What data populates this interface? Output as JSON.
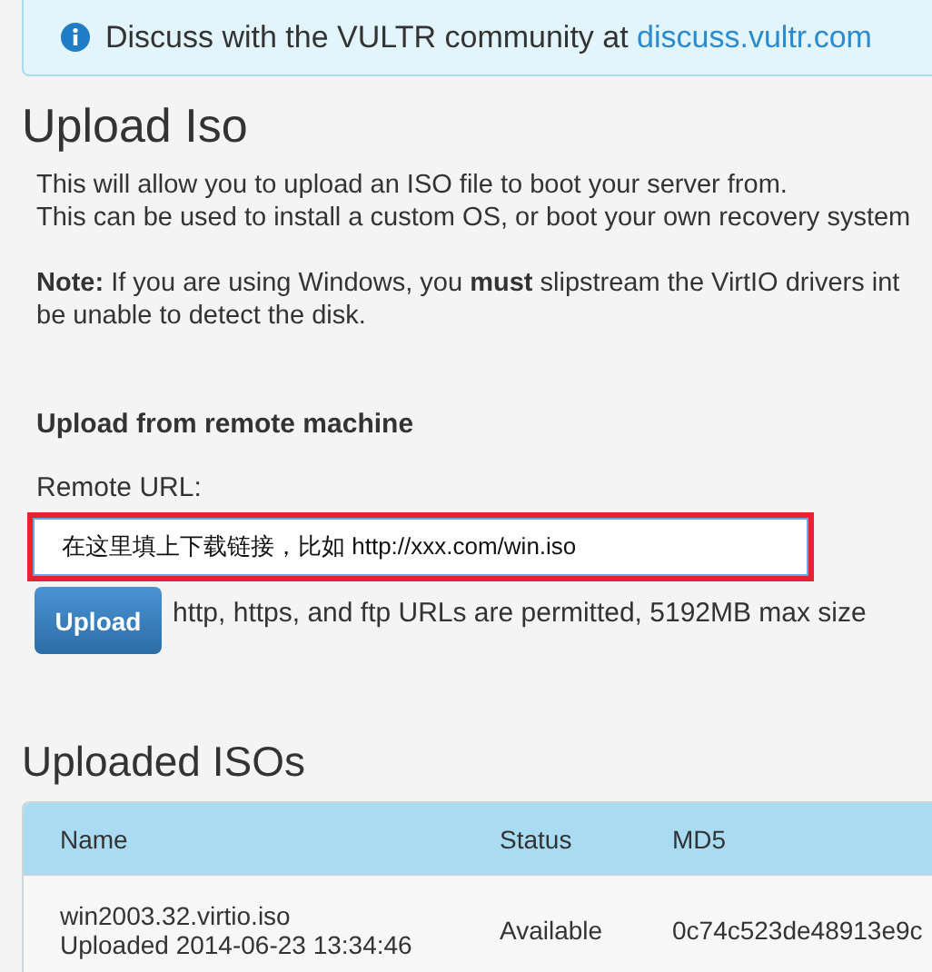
{
  "alert": {
    "text": "Discuss with the VULTR community at ",
    "link": "discuss.vultr.com"
  },
  "title": "Upload Iso",
  "intro": [
    "This will allow you to upload an ISO file to boot your server from.",
    "This can be used to install a custom OS, or boot your own recovery system"
  ],
  "note": [
    "**Note:** If you are using Windows, you **must** slipstream the VirtIO drivers int",
    "be unable to detect the disk."
  ],
  "remote": {
    "heading": "Upload from remote machine",
    "label": "Remote URL:",
    "value": "在这里填上下载链接，比如 http://xxx.com/win.iso",
    "highlighted": true,
    "button": "Upload",
    "hint": "http, https, and ftp URLs are permitted, 5192MB max size"
  },
  "uploaded": {
    "title": "Uploaded ISOs",
    "columns": [
      "Name",
      "Status",
      "MD5"
    ],
    "rows": [
      {
        "name": "win2003.32.virtio.iso",
        "uploaded": "Uploaded 2014-06-23 13:34:46",
        "status": "Available",
        "md5": "0c74c523de48913e9c"
      }
    ]
  }
}
